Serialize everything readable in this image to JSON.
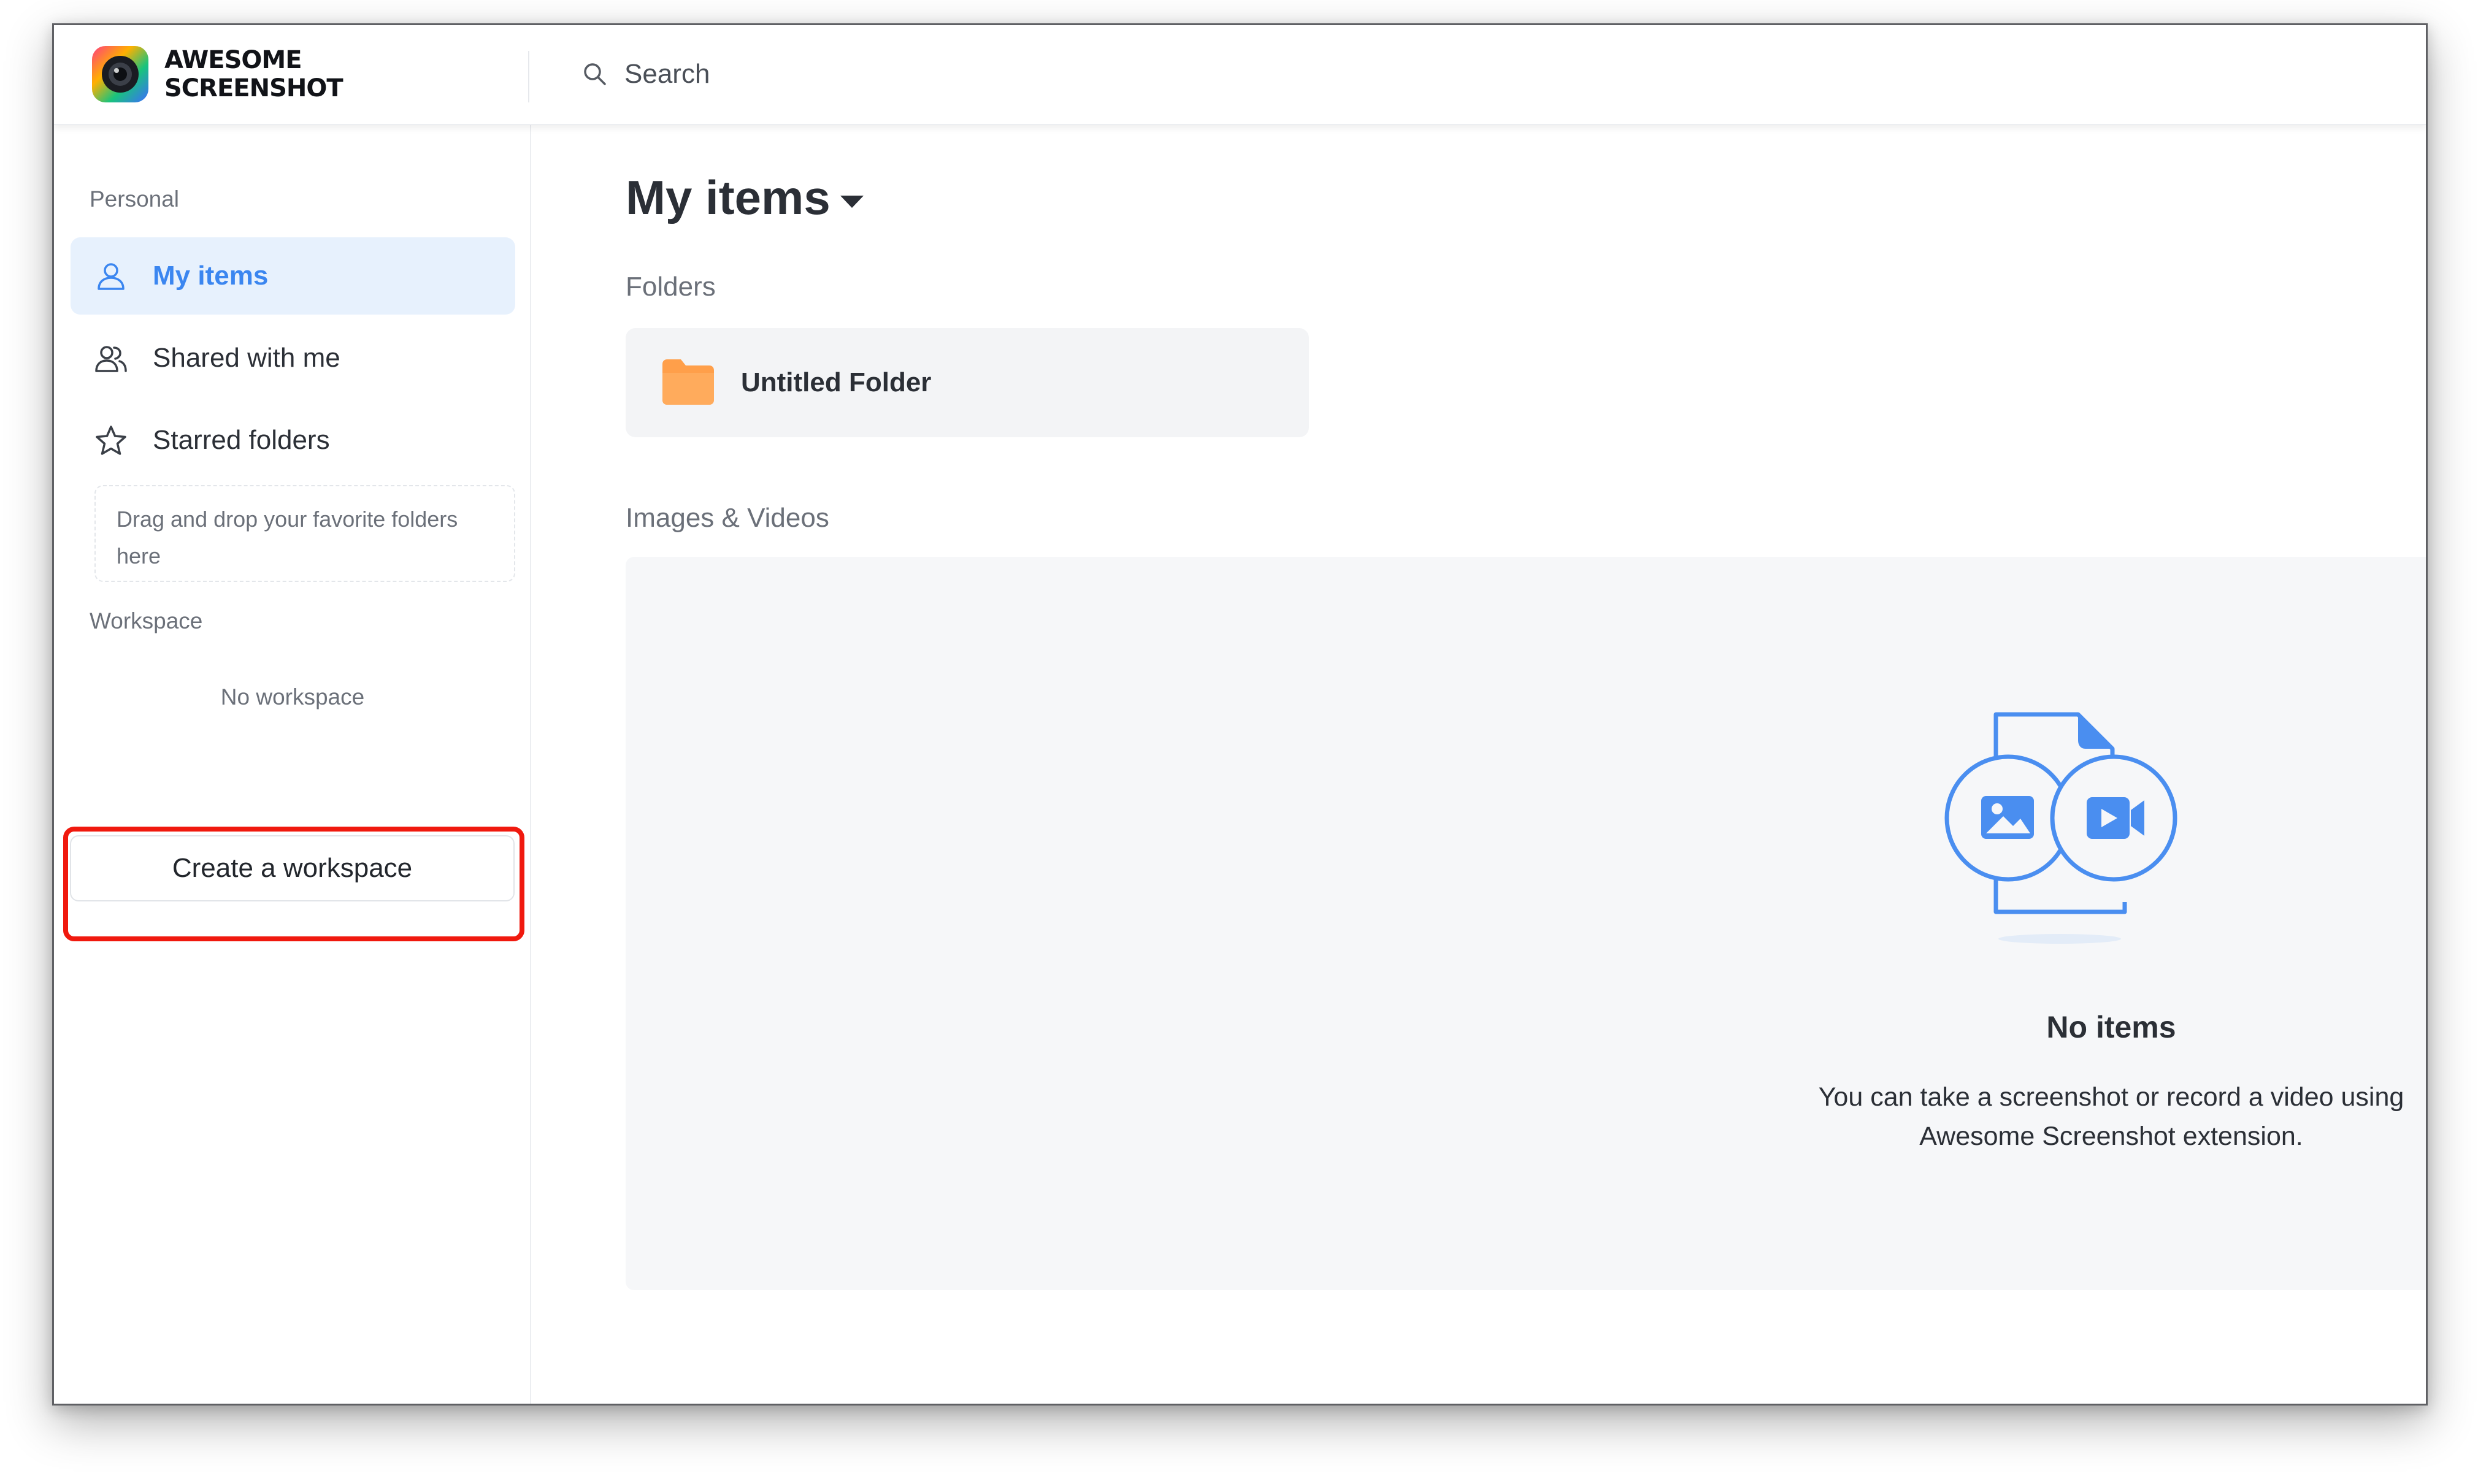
{
  "app": {
    "brand_line1": "AWESOME",
    "brand_line2": "SCREENSHOT"
  },
  "header": {
    "search_placeholder": "Search"
  },
  "sidebar": {
    "personal_label": "Personal",
    "items": [
      {
        "label": "My items",
        "icon": "user-icon",
        "active": true
      },
      {
        "label": "Shared with me",
        "icon": "users-icon",
        "active": false
      },
      {
        "label": "Starred folders",
        "icon": "star-icon",
        "active": false
      }
    ],
    "drop_hint": "Drag and drop your favorite folders here",
    "workspace_label": "Workspace",
    "no_workspace": "No workspace",
    "create_workspace_label": "Create a workspace"
  },
  "main": {
    "title": "My items",
    "folders_label": "Folders",
    "folders": [
      {
        "name": "Untitled Folder",
        "icon": "folder-icon"
      }
    ],
    "media_label": "Images & Videos",
    "empty_title": "No items",
    "empty_desc_line1": "You can take a screenshot or record a video using",
    "empty_desc_line2": "Awesome Screenshot extension."
  },
  "colors": {
    "accent": "#3b86f0",
    "active_bg": "#e7f1fd",
    "folder": "#ff9f4a",
    "highlight": "#f0190e",
    "illustration": "#4a8ef0"
  }
}
